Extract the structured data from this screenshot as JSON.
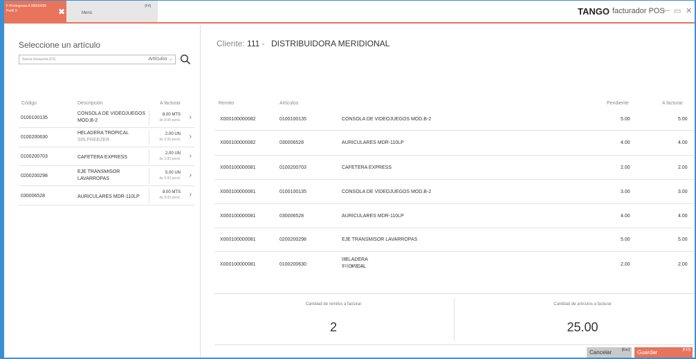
{
  "tabs": {
    "active_line1": "F-Preimpresa A 00000436",
    "active_line2": "Perfil 0",
    "menu_label": "Menú",
    "menu_key": "[F4]"
  },
  "brand": {
    "logo": "TANGO",
    "product": "facturador POS"
  },
  "window": {
    "minimize": "—",
    "maximize": "▭",
    "close": "✕"
  },
  "left": {
    "title": "Seleccione un artículo",
    "search_placeholder": "Nueva búsqueda [F3]",
    "search_scope": "Artículos",
    "columns": [
      "Código",
      "Descripción",
      "A facturar"
    ],
    "items": [
      {
        "code": "0100100135",
        "desc": "CONSOLA DE VIDEOJUEGOS MOD.B-2",
        "desc2": "",
        "qty": "8.00 MTS",
        "pend": "de 8.00 pend."
      },
      {
        "code": "0100200630",
        "desc": "HELADERA TROPICAL",
        "desc2": "SIN FREEZER",
        "qty": "2.00 UN",
        "pend": "de 2.00 pend."
      },
      {
        "code": "0100200703",
        "desc": "CAFETERA EXPRESS",
        "desc2": "",
        "qty": "2.00 UN",
        "pend": "de 2.00 pend."
      },
      {
        "code": "0200200298",
        "desc": "EJE TRANSMISOR LAVARROPAS",
        "desc2": "",
        "qty": "5.00 UN",
        "pend": "de 5.00 pend."
      },
      {
        "code": "030006528",
        "desc": "AURICULARES MDR-110LP",
        "desc2": "",
        "qty": "8.00 MTS",
        "pend": "de 8.00 pend."
      }
    ]
  },
  "client": {
    "label": "Cliente:",
    "code": "111",
    "sep": "-",
    "name": "DISTRIBUIDORA MERIDIONAL"
  },
  "table": {
    "columns": [
      "Remito",
      "Artículos",
      "Pendiente",
      "A facturar"
    ],
    "rows": [
      {
        "remito": "X000100000082",
        "code": "0100100135",
        "desc": "CONSOLA DE VIDEOJUEGOS MOD.B-2",
        "desc2": "",
        "pend": "5.00",
        "fact": "5.00"
      },
      {
        "remito": "X000100000082",
        "code": "030006528",
        "desc": "AURICULARES MDR-110LP",
        "desc2": "",
        "pend": "4.00",
        "fact": "4.00"
      },
      {
        "remito": "X000100000081",
        "code": "0100200703",
        "desc": "CAFETERA EXPRESS",
        "desc2": "",
        "pend": "2.00",
        "fact": "2.00"
      },
      {
        "remito": "X000100000081",
        "code": "0100100135",
        "desc": "CONSOLA DE VIDEOJUEGOS MOD.B-2",
        "desc2": "",
        "pend": "3.00",
        "fact": "3.00"
      },
      {
        "remito": "X000100000081",
        "code": "030006528",
        "desc": "AURICULARES MDR-110LP",
        "desc2": "",
        "pend": "4.00",
        "fact": "4.00"
      },
      {
        "remito": "X000100000081",
        "code": "0200200298",
        "desc": "EJE TRANSMISOR LAVARROPAS",
        "desc2": "",
        "pend": "5.00",
        "fact": "5.00"
      },
      {
        "remito": "X000100000081",
        "code": "0100200630",
        "desc": "HELADERA TROPICAL",
        "desc2": "SIN FREEZER",
        "pend": "2.00",
        "fact": "2.00"
      }
    ]
  },
  "summary": {
    "remitos_label": "Cantidad de remitos a facturar",
    "remitos_value": "2",
    "articulos_label": "Cantidad de artículos a facturar",
    "articulos_value": "25.00"
  },
  "buttons": {
    "cancel": "Cancelar",
    "cancel_key": "[Esc]",
    "save": "Guardar",
    "save_key": "[F10]"
  },
  "colors": {
    "accent": "#e8745c",
    "frame": "#3b8fd1"
  }
}
